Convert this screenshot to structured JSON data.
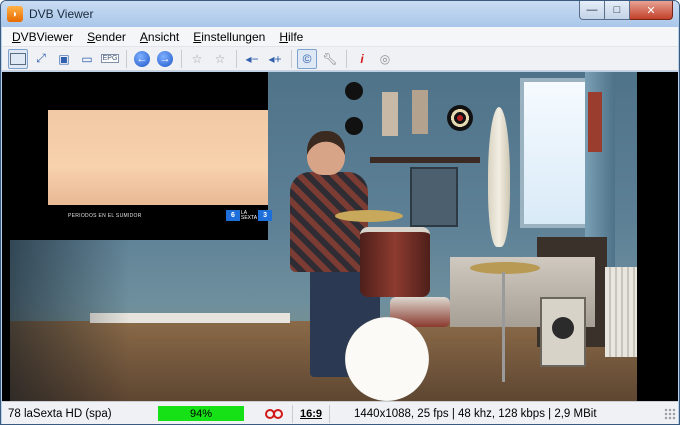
{
  "window": {
    "title": "DVB Viewer",
    "controls": {
      "minimize": "—",
      "maximize": "□",
      "close": "✕"
    }
  },
  "menu": {
    "items": [
      "DVBViewer",
      "Sender",
      "Ansicht",
      "Einstellungen",
      "Hilfe"
    ]
  },
  "toolbar": {
    "buttons": [
      {
        "icon": "screen-icon"
      },
      {
        "icon": "fullscreen-icon"
      },
      {
        "icon": "teletext-icon"
      },
      {
        "icon": "osd-icon"
      },
      {
        "icon": "epg-icon",
        "label": "EPG"
      },
      {
        "icon": "back-arrow-icon"
      },
      {
        "icon": "forward-arrow-icon"
      },
      {
        "icon": "favorite-star-icon"
      },
      {
        "icon": "add-favorite-star-icon"
      },
      {
        "icon": "volume-down-icon"
      },
      {
        "icon": "volume-up-icon"
      },
      {
        "icon": "copyright-icon"
      },
      {
        "icon": "wrench-icon"
      },
      {
        "icon": "info-icon"
      },
      {
        "icon": "record-disc-icon"
      }
    ]
  },
  "pip": {
    "caption": "PERIODOS EN EL SUMIDOR",
    "logo_number": "6",
    "logo_text_top": "LA",
    "logo_text_bottom": "SEXTA",
    "logo_channel": "3"
  },
  "statusbar": {
    "channel": "78 laSexta HD (spa)",
    "signal": "94%",
    "aspect": "16:9",
    "stream_info": "1440x1088, 25 fps | 48 khz, 128 kbps | 2,9 MBit",
    "colors": {
      "signal_bar": "#16e016",
      "record": "#d21818"
    }
  }
}
